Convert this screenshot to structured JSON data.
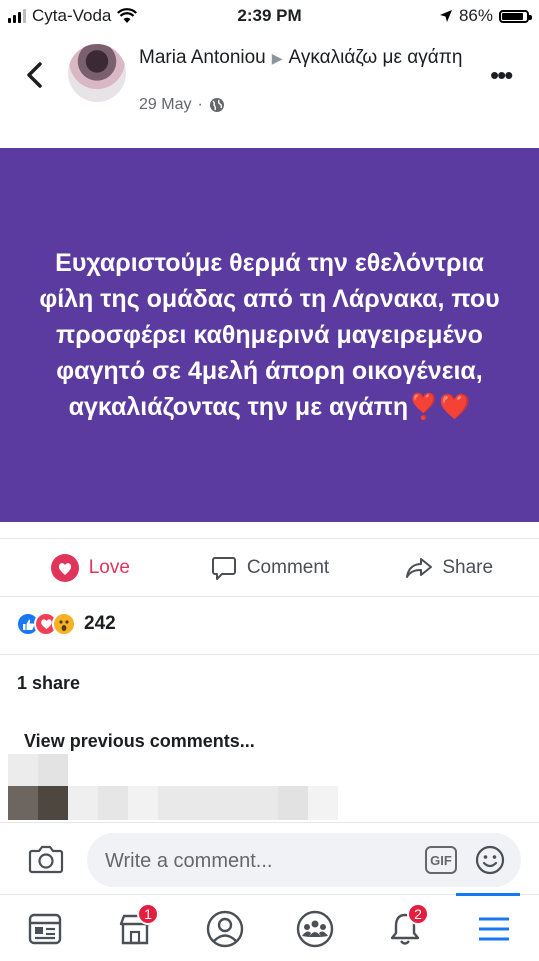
{
  "status_bar": {
    "carrier": "Cyta-Voda",
    "time": "2:39 PM",
    "battery": "86%",
    "battery_level": 0.86
  },
  "post": {
    "author": "Maria Antoniou",
    "feeling": "Αγκαλιάζω με αγάπη",
    "date": "29 May",
    "privacy_icon": "globe-icon",
    "text": "Ευχαριστούμε θερμά την εθελόντρια φίλη της ομάδας από τη Λάρνακα, που προσφέρει καθημερινά μαγειρεμένο φαγητό σε 4μελή άπορη οικογένεια, αγκαλιάζοντας την με αγάπη❣️❤️",
    "background_color": "#5b3b9f"
  },
  "actions": {
    "love": "Love",
    "comment": "Comment",
    "share": "Share"
  },
  "reactions": {
    "icons": [
      "like-icon",
      "love-icon",
      "wow-icon"
    ],
    "count": "242"
  },
  "shares": "1 share",
  "comments": {
    "view_previous": "View previous comments..."
  },
  "composer": {
    "placeholder": "Write a comment...",
    "gif": "GIF"
  },
  "tabbar": {
    "items": [
      {
        "icon": "news-feed-icon",
        "badge": ""
      },
      {
        "icon": "marketplace-icon",
        "badge": "1"
      },
      {
        "icon": "profile-icon",
        "badge": ""
      },
      {
        "icon": "groups-icon",
        "badge": ""
      },
      {
        "icon": "notifications-icon",
        "badge": "2"
      },
      {
        "icon": "menu-icon",
        "badge": ""
      }
    ]
  },
  "colors": {
    "love_red": "#e0345b",
    "facebook_blue": "#1877f2",
    "badge_red": "#e41e3f"
  }
}
